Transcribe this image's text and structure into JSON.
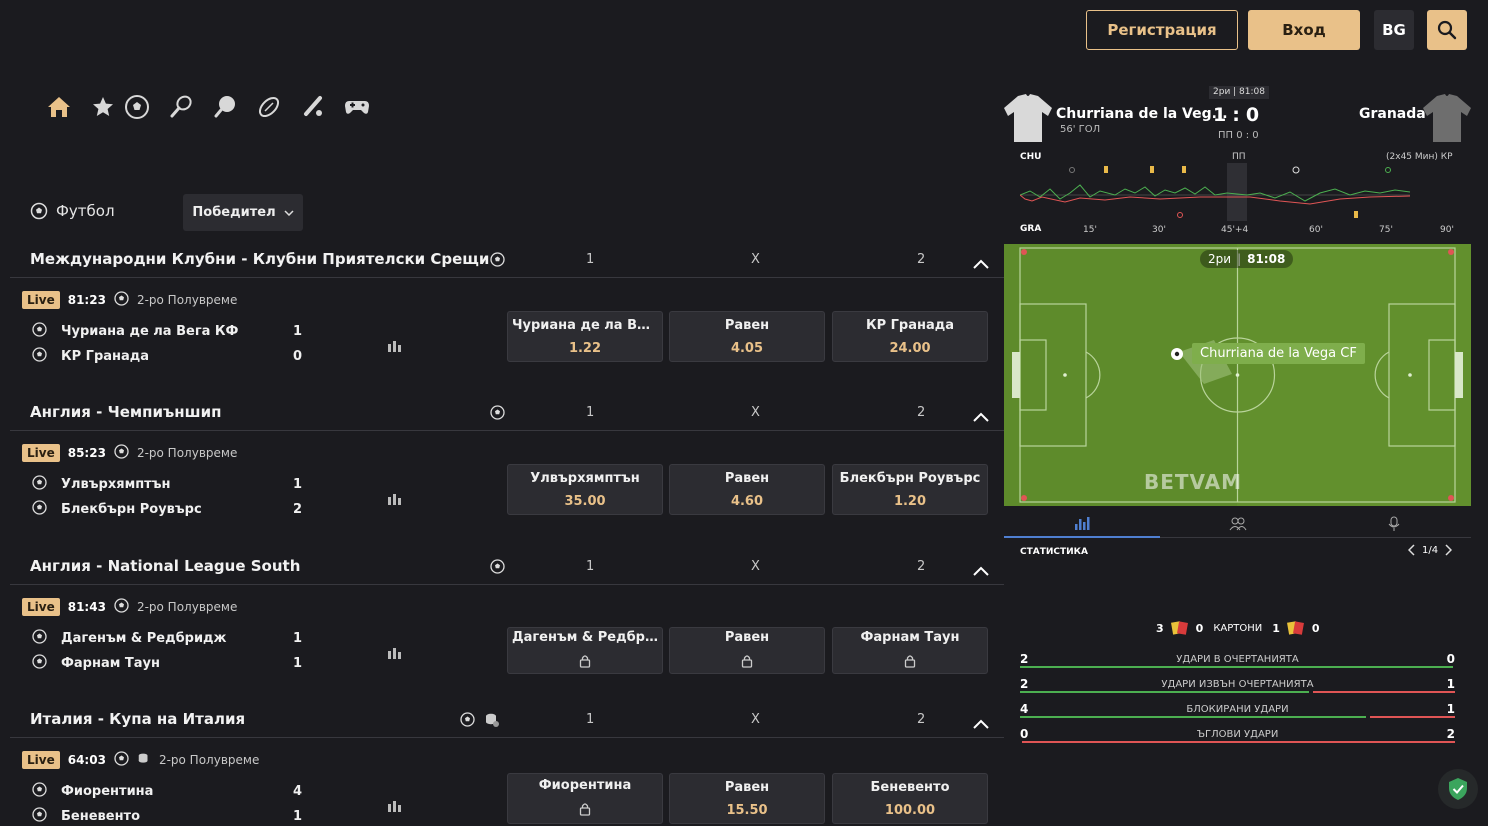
{
  "header": {
    "register_label": "Регистрация",
    "login_label": "Вход",
    "lang_label": "BG"
  },
  "colors": {
    "accent": "#e9c189",
    "bg": "#1b1b1f",
    "button": "#2c2c31",
    "pitch": "#5e8b2b",
    "green": "#4caf50",
    "red": "#e05555"
  },
  "sport_icons": [
    "home-icon",
    "star-icon",
    "football-icon",
    "tennis-icon",
    "table-tennis-icon",
    "rugby-icon",
    "cricket-icon",
    "esports-icon"
  ],
  "sport_filter": {
    "title": "Футбол",
    "market": "Победител"
  },
  "leagues": [
    {
      "name": "Международни Клубни - Клубни Приятелски Срещи",
      "cols": [
        "1",
        "X",
        "2"
      ],
      "match": {
        "live": "Live",
        "time": "81:23",
        "period": "2-ро Полувреме",
        "teams": [
          {
            "name": "Чуриана де ла Вега КФ",
            "score": "1"
          },
          {
            "name": "КР Гранада",
            "score": "0"
          }
        ],
        "odds": [
          {
            "label": "Чуриана де ла Вег...",
            "value": "1.22"
          },
          {
            "label": "Равен",
            "value": "4.05"
          },
          {
            "label": "КР Гранада",
            "value": "24.00"
          }
        ]
      }
    },
    {
      "name": "Англия - Чемпиъншип",
      "cols": [
        "1",
        "X",
        "2"
      ],
      "match": {
        "live": "Live",
        "time": "85:23",
        "period": "2-ро Полувреме",
        "teams": [
          {
            "name": "Улвърхямптън",
            "score": "1"
          },
          {
            "name": "Блекбърн Роувърс",
            "score": "2"
          }
        ],
        "odds": [
          {
            "label": "Улвърхямптън",
            "value": "35.00"
          },
          {
            "label": "Равен",
            "value": "4.60"
          },
          {
            "label": "Блекбърн Роувърс",
            "value": "1.20"
          }
        ]
      }
    },
    {
      "name": "Англия - National League South",
      "cols": [
        "1",
        "X",
        "2"
      ],
      "match": {
        "live": "Live",
        "time": "81:43",
        "period": "2-ро Полувреме",
        "teams": [
          {
            "name": "Дагенъм & Редбридж",
            "score": "1"
          },
          {
            "name": "Фарнам Таун",
            "score": "1"
          }
        ],
        "odds": [
          {
            "label": "Дагенъм & Редбридж",
            "value": ""
          },
          {
            "label": "Равен",
            "value": ""
          },
          {
            "label": "Фарнам Таун",
            "value": ""
          }
        ]
      }
    },
    {
      "name": "Италия - Купа на Италия",
      "cols": [
        "1",
        "X",
        "2"
      ],
      "match": {
        "live": "Live",
        "time": "64:03",
        "period": "2-ро Полувреме",
        "teams": [
          {
            "name": "Фиорентина",
            "score": "4"
          },
          {
            "name": "Беневенто",
            "score": "1"
          }
        ],
        "odds": [
          {
            "label": "Фиорентина",
            "value": ""
          },
          {
            "label": "Равен",
            "value": "15.50"
          },
          {
            "label": "Беневенто",
            "value": "100.00"
          }
        ]
      }
    }
  ],
  "live_panel": {
    "home_team": "Churriana de la Veg...",
    "away_team": "Granada",
    "home_note": "56' ГОЛ",
    "period_time": "2ри | 81:08",
    "score_home": "1",
    "score_sep": ":",
    "score_away": "0",
    "penalties": "ПП 0 : 0",
    "timeline": {
      "home_abbr": "CHU",
      "away_abbr": "GRA",
      "mid_label": "ПП",
      "format_label": "(2x45 Мин) КР",
      "ticks": [
        "15'",
        "30'",
        "45'+4",
        "60'",
        "75'",
        "90'"
      ]
    },
    "pitch": {
      "clock_period": "2ри",
      "clock_time": "81:08",
      "attack_team": "Churriana de la Vega CF",
      "watermark": "BETVAM"
    },
    "stats": {
      "title": "СТАТИСТИКА",
      "pager": "1/4",
      "cards": {
        "home_yellow": "3",
        "home_red": "0",
        "label": "КАРТОНИ",
        "away_yellow": "1",
        "away_red": "0"
      },
      "rows": [
        {
          "label": "УДАРИ В ОЧЕРТАНИЯТА",
          "home": "2",
          "away": "0",
          "home_frac": 1.0
        },
        {
          "label": "УДАРИ ИЗВЪН ОЧЕРТАНИЯТА",
          "home": "2",
          "away": "1",
          "home_frac": 0.67
        },
        {
          "label": "БЛОКИРАНИ УДАРИ",
          "home": "4",
          "away": "1",
          "home_frac": 0.8
        },
        {
          "label": "ЪГЛОВИ УДАРИ",
          "home": "0",
          "away": "2",
          "home_frac": 0.0
        }
      ]
    }
  }
}
